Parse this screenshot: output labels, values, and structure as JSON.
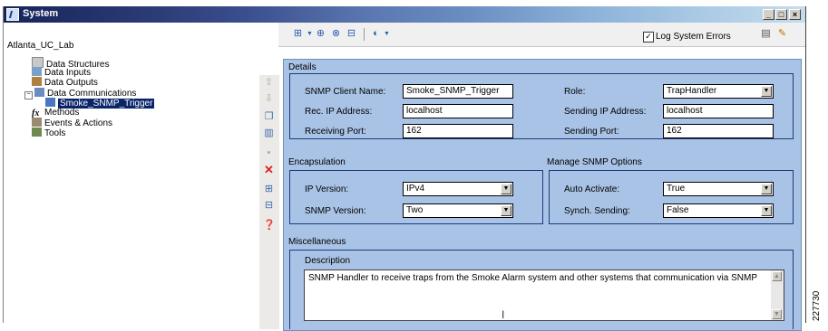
{
  "window": {
    "title": "System"
  },
  "project": {
    "name": "Atlanta_UC_Lab"
  },
  "toolbar": {
    "log_errors_label": "Log System Errors",
    "log_errors_checked": true
  },
  "tree": {
    "items": [
      {
        "label": "Data Structures",
        "icon": "folder-icon"
      },
      {
        "label": "Data Inputs",
        "icon": "input-icon"
      },
      {
        "label": "Data Outputs",
        "icon": "output-icon"
      },
      {
        "label": "Data Communications",
        "icon": "network-icon"
      },
      {
        "label": "Smoke_SNMP_Trigger",
        "icon": "snmp-icon",
        "selected": true
      },
      {
        "label": "Methods",
        "icon": "fx-icon"
      },
      {
        "label": "Events & Actions",
        "icon": "events-icon"
      },
      {
        "label": "Tools",
        "icon": "tools-icon"
      }
    ]
  },
  "details": {
    "title": "Details",
    "client_name_label": "SNMP Client Name:",
    "client_name_value": "Smoke_SNMP_Trigger",
    "role_label": "Role:",
    "role_value": "TrapHandler",
    "rec_ip_label": "Rec. IP Address:",
    "rec_ip_value": "localhost",
    "send_ip_label": "Sending IP Address:",
    "send_ip_value": "localhost",
    "recv_port_label": "Receiving Port:",
    "recv_port_value": "162",
    "send_port_label": "Sending Port:",
    "send_port_value": "162"
  },
  "encapsulation": {
    "title": "Encapsulation",
    "ip_version_label": "IP Version:",
    "ip_version_value": "IPv4",
    "snmp_version_label": "SNMP Version:",
    "snmp_version_value": "Two"
  },
  "manage": {
    "title": "Manage SNMP Options",
    "auto_activate_label": "Auto Activate:",
    "auto_activate_value": "True",
    "synch_label": "Synch. Sending:",
    "synch_value": "False"
  },
  "misc": {
    "title": "Miscellaneous",
    "description_label": "Description",
    "description_value": "SNMP Handler to receive traps from the Smoke Alarm system and other systems that communication via SNMP"
  },
  "figure_id": "227730"
}
